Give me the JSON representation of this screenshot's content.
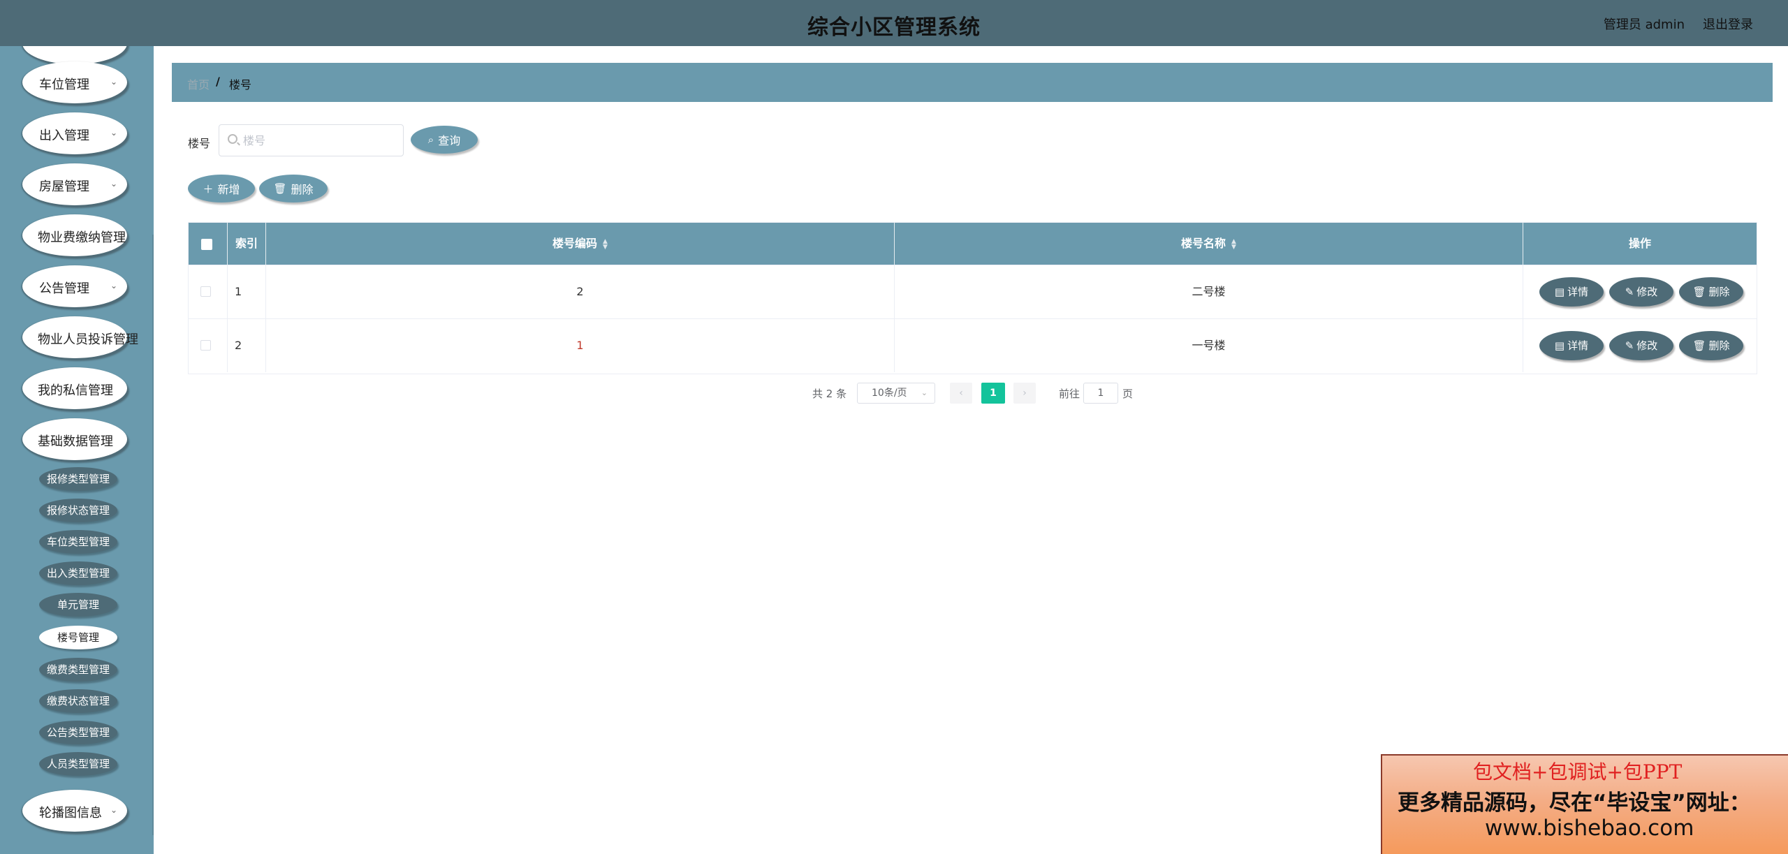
{
  "header": {
    "title": "综合小区管理系统",
    "user": "管理员 admin",
    "logout": "退出登录"
  },
  "sidebar": {
    "menus": [
      {
        "label": "车位管理",
        "chevron": "⌄"
      },
      {
        "label": "出入管理",
        "chevron": "⌄"
      },
      {
        "label": "房屋管理",
        "chevron": "⌄"
      },
      {
        "label": "物业费缴纳管理",
        "chevron": ""
      },
      {
        "label": "公告管理",
        "chevron": "⌄"
      },
      {
        "label": "物业人员投诉管理",
        "chevron": ""
      },
      {
        "label": "我的私信管理",
        "chevron": ""
      },
      {
        "label": "基础数据管理",
        "chevron": ""
      }
    ],
    "submenus": [
      "报修类型管理",
      "报修状态管理",
      "车位类型管理",
      "出入类型管理",
      "单元管理",
      "楼号管理",
      "缴费类型管理",
      "缴费状态管理",
      "公告类型管理",
      "人员类型管理"
    ],
    "bottom_menu": {
      "label": "轮播图信息",
      "chevron": "⌄"
    }
  },
  "breadcrumb": {
    "home": "首页",
    "separator": "/",
    "current": "楼号"
  },
  "search": {
    "label": "楼号",
    "placeholder": "楼号",
    "value": "",
    "query_button": "查询"
  },
  "actions": {
    "add": "新增",
    "delete": "删除"
  },
  "table": {
    "headers": {
      "index": "索引",
      "code": "楼号编码",
      "name": "楼号名称",
      "ops": "操作"
    },
    "rows": [
      {
        "index": "1",
        "code": "2",
        "name": "二号楼"
      },
      {
        "index": "2",
        "code": "1",
        "name": "一号楼"
      }
    ],
    "row_actions": {
      "detail": "详情",
      "edit": "修改",
      "delete": "删除"
    }
  },
  "pagination": {
    "total": "共 2 条",
    "page_size": "10条/页",
    "current_page": "1",
    "goto_label": "前往",
    "goto_value": "1",
    "page_unit": "页"
  },
  "promo": {
    "line1": "包文档+包调试+包PPT",
    "line2": "更多精品源码，尽在“毕设宝”网址：",
    "line3": "www.bishebao.com"
  },
  "colors": {
    "header_bg": "#4e6b77",
    "sidebar_bg": "#6a9aad",
    "accent": "#6a9aad",
    "active_page": "#13c39b"
  }
}
